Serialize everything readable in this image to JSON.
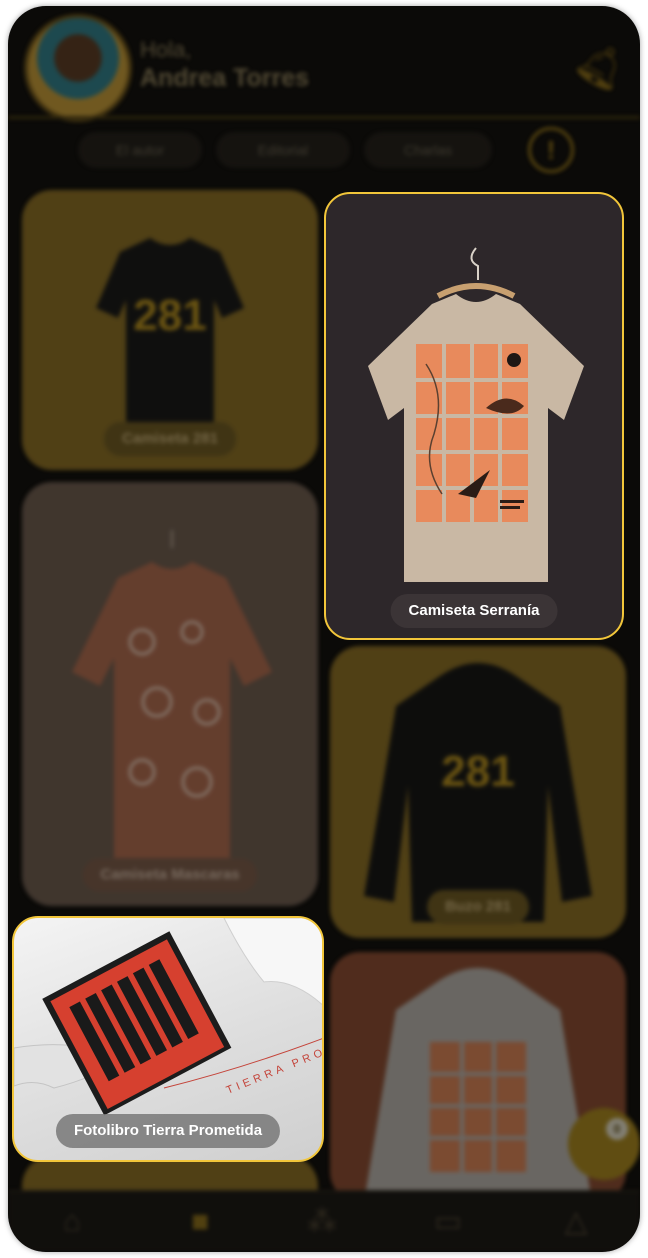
{
  "header": {
    "greeting": "Hola,",
    "user_name": "Andrea Torres"
  },
  "filters": [
    {
      "label": "El autor"
    },
    {
      "label": "Editorial"
    },
    {
      "label": "Charlas"
    }
  ],
  "products": [
    {
      "label": "Camiseta 281"
    },
    {
      "label": "Camiseta Mascaras"
    },
    {
      "label": "Camiseta Serranía"
    },
    {
      "label": "Buzo 281"
    },
    {
      "label": "Fotolibro Tierra Prometida"
    }
  ],
  "cart_count": "0",
  "print_281": "281",
  "book_cover_text": "TIERRA PROMETIDA",
  "colors": {
    "accent": "#f2c63a",
    "background": "#0b0a08",
    "mustard": "#8a6d22"
  }
}
